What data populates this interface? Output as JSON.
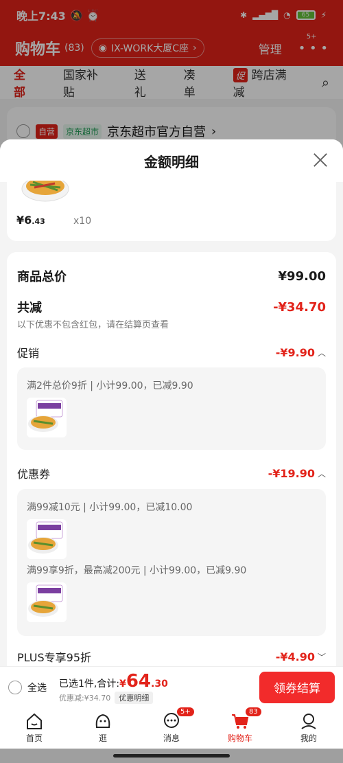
{
  "status": {
    "time": "晚上7:43",
    "battery": "65"
  },
  "header": {
    "title": "购物车",
    "count": "(83)",
    "address": "IX-WORK大厦C座",
    "manage": "管理",
    "more_badge": "5+"
  },
  "tabs": [
    {
      "label": "全部"
    },
    {
      "label": "国家补贴"
    },
    {
      "label": "送礼"
    },
    {
      "label": "凑单"
    },
    {
      "label": "跨店满减",
      "tag": "促"
    }
  ],
  "shop": {
    "tag_self": "自营",
    "tag_market": "京东超市",
    "name": "京东超市官方自营"
  },
  "sheet": {
    "title": "金额明细",
    "item": {
      "price_int": "¥6",
      "price_dec": ".43",
      "qty": "x10"
    },
    "total_label": "商品总价",
    "total_value": "¥99.00",
    "reduce_label": "共减",
    "reduce_value": "-¥34.70",
    "reduce_note": "以下优惠不包含红包，请在结算页查看",
    "promo": {
      "label": "促销",
      "value": "-¥9.90",
      "rule": "满2件总价9折 | 小计99.00，已减9.90"
    },
    "coupon": {
      "label": "优惠券",
      "value": "-¥19.90",
      "rule1": "满99减10元 | 小计99.00，已减10.00",
      "rule2": "满99享9折，最高减200元 | 小计99.00，已减9.90"
    },
    "plus": {
      "label": "PLUS专享95折",
      "value": "-¥4.90"
    }
  },
  "checkout": {
    "select_all": "全选",
    "selected": "已选1件,合计:",
    "currency": "¥",
    "total_int": "64",
    "total_dec": ".30",
    "discount": "优惠减:¥34.70",
    "detail_btn": "优惠明细",
    "pay": "领券结算"
  },
  "tabbar": [
    {
      "label": "首页"
    },
    {
      "label": "逛"
    },
    {
      "label": "消息",
      "badge": "5+"
    },
    {
      "label": "购物车",
      "badge": "83"
    },
    {
      "label": "我的"
    }
  ],
  "colors": {
    "brand_red": "#e2231a",
    "pay_red": "#f22b2b"
  }
}
